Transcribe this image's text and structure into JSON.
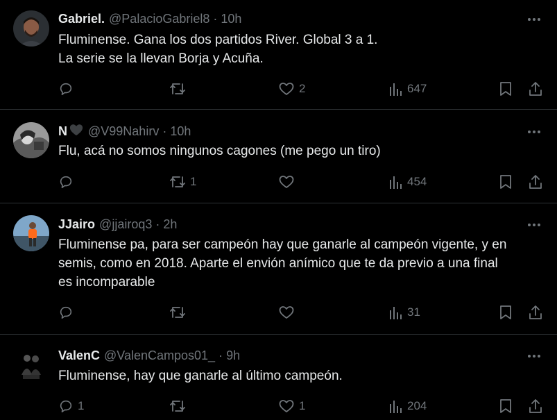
{
  "tweets": [
    {
      "name": "Gabriel.",
      "handle": "@PalacioGabriel8",
      "time": "10h",
      "lines": [
        "Fluminense. Gana los dos partidos River. Global 3 a 1.",
        "La serie se la llevan Borja y Acuña."
      ],
      "replies": "",
      "retweets": "",
      "likes": "2",
      "views": "647"
    },
    {
      "name": "N",
      "name_emoji": "black-heart",
      "handle": "@V99Nahirv",
      "time": "10h",
      "lines": [
        "Flu, acá no somos ningunos cagones (me pego un tiro)"
      ],
      "replies": "",
      "retweets": "1",
      "likes": "",
      "views": "454"
    },
    {
      "name": "JJairo",
      "handle": "@jjairoq3",
      "time": "2h",
      "lines": [
        "Fluminense pa, para ser campeón hay que ganarle al campeón vigente, y en",
        "semis, como en 2018. Aparte el envión anímico que te da previo a una final",
        "es incomparable"
      ],
      "replies": "",
      "retweets": "",
      "likes": "",
      "views": "31"
    },
    {
      "name": "ValenC",
      "handle": "@ValenCampos01_",
      "time": "9h",
      "lines": [
        "Fluminense, hay que ganarle al último campeón."
      ],
      "replies": "1",
      "retweets": "",
      "likes": "1",
      "views": "204"
    }
  ],
  "separator": "·",
  "colors": {
    "background": "#000000",
    "text": "#e7e9ea",
    "muted": "#71767b",
    "divider": "#2f3336"
  },
  "icons": [
    "reply-icon",
    "retweet-icon",
    "like-icon",
    "views-icon",
    "bookmark-icon",
    "share-icon",
    "more-icon"
  ]
}
